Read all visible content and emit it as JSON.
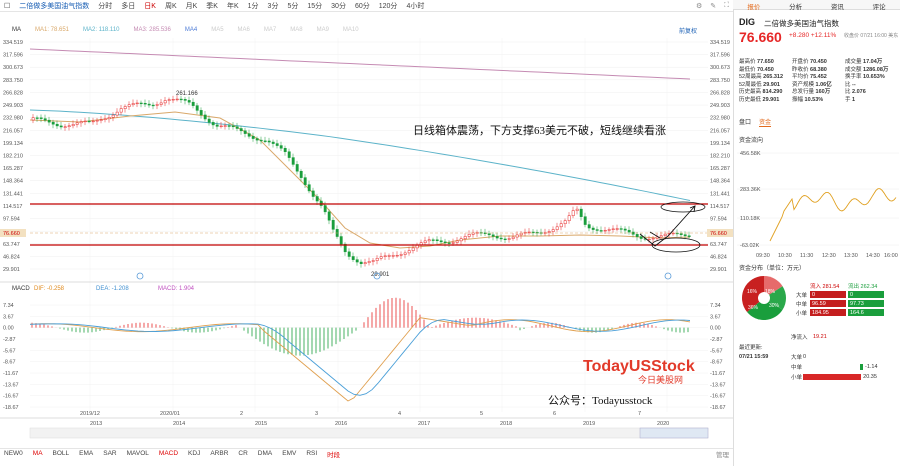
{
  "topbar": {
    "title": "二倍做多美国油气指数",
    "periods": [
      "分时",
      "多日",
      "日K",
      "周K",
      "月K",
      "季K",
      "年K",
      "1分",
      "3分",
      "5分",
      "15分",
      "30分",
      "60分",
      "120分",
      "4小时"
    ],
    "active_period": "日K"
  },
  "ma_legend": {
    "ma": "MA",
    "ma1": "MA1: 78.651",
    "ma2": "MA2: 118.110",
    "ma3": "MA3: 285.536",
    "ma4": "MA4",
    "ma5": "MA5",
    "ma6": "MA6",
    "ma7": "MA7",
    "ma8": "MA8",
    "ma9": "MA9",
    "ma10": "MA10",
    "right_label": "前复权"
  },
  "price_axis": [
    "334.519",
    "317.596",
    "300.673",
    "283.750",
    "266.828",
    "249.903",
    "232.980",
    "216.057",
    "199.134",
    "182.210",
    "165.287",
    "148.364",
    "131.441",
    "114.517",
    "97.594",
    "80.671",
    "63.747",
    "46.824",
    "29.901"
  ],
  "price_labels": {
    "current_left": "76.660",
    "current_right": "76.660",
    "high_note": "261.166",
    "low_note": "29.901"
  },
  "annotation": "日线箱体震荡，下方支撑63美元不破，短线继续看涨",
  "macd_legend": {
    "macd": "MACD",
    "dif": "DIF: -0.258",
    "dea": "DEA: -1.208",
    "macd_val": "MACD: 1.904"
  },
  "macd_axis": [
    "7.34",
    "3.67",
    "0.00",
    "-2.87",
    "-5.67",
    "-8.67",
    "-11.67",
    "-13.67",
    "-16.67",
    "-18.67"
  ],
  "x_dates_upper": [
    "2019/12",
    "2020/01",
    "2",
    "3",
    "4",
    "5",
    "6",
    "7"
  ],
  "x_years": [
    "2013",
    "2014",
    "2015",
    "2016",
    "2017",
    "2018",
    "2019",
    "2020"
  ],
  "watermark": {
    "brand": "TodayUSStock",
    "brand_cn": "今日美股网",
    "account": "公众号：Todayusstock"
  },
  "indicators": [
    "NEW0",
    "MA",
    "BOLL",
    "EMA",
    "SAR",
    "MAVOL",
    "MACD",
    "KDJ",
    "ARBR",
    "CR",
    "DMA",
    "EMV",
    "RSI",
    "时段"
  ],
  "active_indicator": "MACD",
  "manage_label": "管理",
  "right_tabs": [
    "报价",
    "分析",
    "资讯",
    "评论"
  ],
  "quote": {
    "code": "DIG",
    "name": "二倍做多美国油气指数",
    "price": "76.660",
    "change": "+8.280 +12.11%",
    "timestamp": "收盘价 07/21 16:00 美东",
    "rows": [
      [
        [
          "最高价",
          "77.650"
        ],
        [
          "开盘价",
          "70.450"
        ],
        [
          "成交量",
          "17.04万"
        ]
      ],
      [
        [
          "最低价",
          "70.450"
        ],
        [
          "昨收价",
          "68.380"
        ],
        [
          "成交额",
          "1286.08万"
        ]
      ],
      [
        [
          "52周最高",
          "265.312"
        ],
        [
          "平均价",
          "75.452"
        ],
        [
          "换手率",
          "10.653%"
        ]
      ],
      [
        [
          "52周最低",
          "29.901"
        ],
        [
          "资产规模",
          "1.06亿"
        ],
        [
          "比",
          "--"
        ]
      ],
      [
        [
          "历史最高",
          "814.290"
        ],
        [
          "总发行量",
          "160万"
        ],
        [
          "比",
          "2.076"
        ]
      ],
      [
        [
          "历史最低",
          "29.901"
        ],
        [
          "振幅",
          "10.53%"
        ],
        [
          "手",
          "1"
        ]
      ]
    ]
  },
  "sub_tabs": [
    "盘口",
    "资金"
  ],
  "active_sub_tab": "资金",
  "fund_flow_title": "资金流向",
  "fund_axis": [
    "456.58K",
    "283.36K",
    "110.18K",
    "-63.02K"
  ],
  "fund_time": [
    "09:30",
    "10:30",
    "11:30",
    "12:30",
    "13:30",
    "14:30",
    "16:00"
  ],
  "fund_dist_title": "资金分布（单位：万元）",
  "donut_labels": [
    "16%",
    "18%",
    "30%",
    "36%"
  ],
  "flow_table": {
    "in_label": "流入",
    "in_total": "281.54",
    "out_label": "流出",
    "out_total": "262.34",
    "rows": [
      {
        "label": "大单",
        "in": "0",
        "out": "0"
      },
      {
        "label": "中单",
        "in": "96.59",
        "out": "97.73"
      },
      {
        "label": "小单",
        "in": "184.95",
        "out": "164.6"
      }
    ]
  },
  "net_inflow": {
    "label": "净流入",
    "value": "19.21",
    "latest_label": "最近更新:",
    "latest_time": "07/21 15:59",
    "rows": [
      {
        "label": "大单",
        "value": "0"
      },
      {
        "label": "中单",
        "value": "-1.14"
      },
      {
        "label": "小单",
        "value": "20.35"
      }
    ]
  },
  "colors": {
    "up": "#e62727",
    "down": "#1a9e3c",
    "ma1": "#d9a86a",
    "ma2": "#5cb3c9",
    "ma3": "#c58bb3",
    "support_line": "#c00000",
    "accent": "#e36b1e"
  }
}
